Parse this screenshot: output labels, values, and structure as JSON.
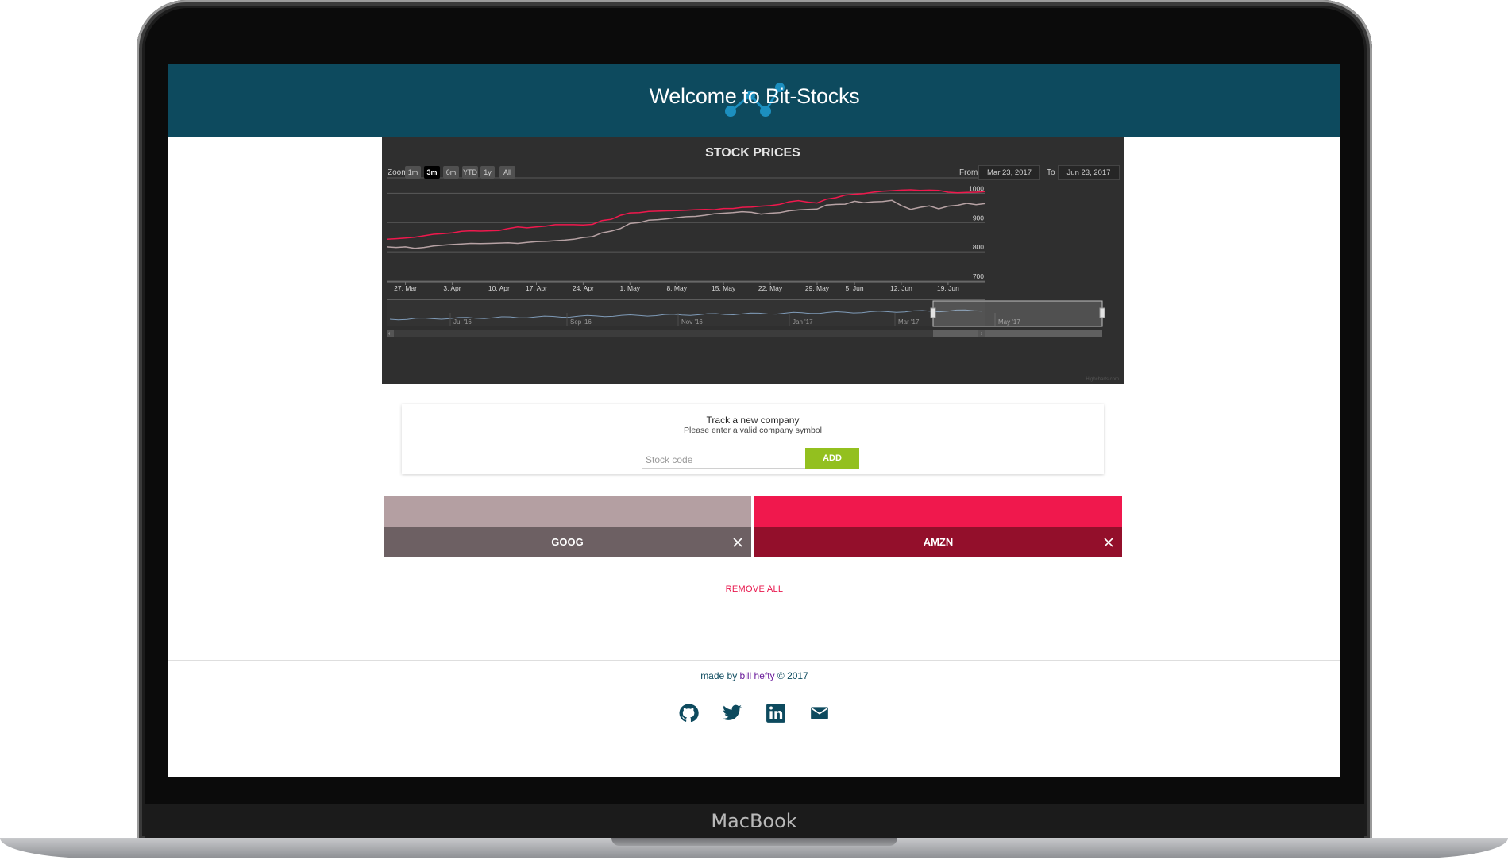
{
  "device": {
    "brand": "MacBook"
  },
  "header": {
    "title": "Welcome to Bit-Stocks"
  },
  "chart": {
    "title": "STOCK PRICES",
    "zoom_label": "Zoom",
    "zoom_buttons": [
      "1m",
      "3m",
      "6m",
      "YTD",
      "1y",
      "All"
    ],
    "active_zoom": "3m",
    "from_label": "From",
    "from_value": "Mar 23, 2017",
    "to_label": "To",
    "to_value": "Jun 23, 2017",
    "credit": "Highcharts.com",
    "colors": {
      "GOOG": "#b7a2a4",
      "AMZN": "#f0184d"
    }
  },
  "chart_data": {
    "type": "line",
    "title": "STOCK PRICES",
    "x": [
      "23 Mar",
      "24 Mar",
      "27 Mar",
      "28 Mar",
      "29 Mar",
      "30 Mar",
      "31 Mar",
      "3 Apr",
      "4 Apr",
      "5 Apr",
      "6 Apr",
      "7 Apr",
      "10 Apr",
      "11 Apr",
      "12 Apr",
      "13 Apr",
      "17 Apr",
      "18 Apr",
      "19 Apr",
      "20 Apr",
      "21 Apr",
      "24 Apr",
      "25 Apr",
      "26 Apr",
      "27 Apr",
      "28 Apr",
      "1 May",
      "2 May",
      "3 May",
      "4 May",
      "5 May",
      "8 May",
      "9 May",
      "10 May",
      "11 May",
      "12 May",
      "15 May",
      "16 May",
      "17 May",
      "18 May",
      "19 May",
      "22 May",
      "23 May",
      "24 May",
      "25 May",
      "26 May",
      "30 May",
      "31 May",
      "1 Jun",
      "2 Jun",
      "5 Jun",
      "6 Jun",
      "7 Jun",
      "8 Jun",
      "9 Jun",
      "12 Jun",
      "13 Jun",
      "14 Jun",
      "15 Jun",
      "16 Jun",
      "19 Jun",
      "20 Jun",
      "21 Jun",
      "22 Jun",
      "23 Jun"
    ],
    "series": [
      {
        "name": "AMZN",
        "values": [
          843,
          845,
          847,
          850,
          855,
          860,
          862,
          865,
          870,
          872,
          871,
          872,
          873,
          880,
          885,
          882,
          885,
          888,
          893,
          893,
          893,
          892,
          894,
          907,
          911,
          925,
          933,
          934,
          938,
          939,
          940,
          941,
          942,
          944,
          945,
          944,
          948,
          948,
          952,
          953,
          956,
          958,
          962,
          971,
          975,
          970,
          967,
          980,
          985,
          994,
          997,
          999,
          1004,
          1007,
          1009,
          1011,
          1012,
          1010,
          1011,
          1010,
          1004,
          1002,
          1003,
          1004,
          1006
        ]
      },
      {
        "name": "GOOG",
        "values": [
          817,
          815,
          817,
          812,
          815,
          820,
          823,
          825,
          827,
          829,
          828,
          829,
          830,
          831,
          829,
          832,
          835,
          836,
          838,
          840,
          843,
          849,
          852,
          865,
          871,
          880,
          897,
          900,
          908,
          910,
          913,
          917,
          920,
          921,
          925,
          930,
          932,
          934,
          937,
          935,
          929,
          932,
          934,
          940,
          943,
          945,
          946,
          960,
          962,
          963,
          973,
          968,
          971,
          972,
          976,
          958,
          945,
          952,
          957,
          947,
          956,
          959,
          966,
          961,
          965
        ]
      }
    ],
    "ylim": [
      700,
      1050
    ],
    "y_ticks": [
      "700",
      "800",
      "900",
      "1000"
    ],
    "x_ticks": [
      "27. Mar",
      "3. Apr",
      "10. Apr",
      "17. Apr",
      "24. Apr",
      "1. May",
      "8. May",
      "15. May",
      "22. May",
      "29. May",
      "5. Jun",
      "12. Jun",
      "19. Jun"
    ],
    "navigator_labels": [
      "Jul '16",
      "Sep '16",
      "Nov '16",
      "Jan '17",
      "Mar '17",
      "May '17"
    ],
    "grid": true
  },
  "track": {
    "title": "Track a new company",
    "subtitle": "Please enter a valid company symbol",
    "placeholder": "Stock code",
    "value": "",
    "add_label": "ADD"
  },
  "stocks": [
    {
      "symbol": "GOOG",
      "top_color": "#b49fa2",
      "bottom_color": "#6d6063"
    },
    {
      "symbol": "AMZN",
      "top_color": "#f0184d",
      "bottom_color": "#930f2b"
    }
  ],
  "remove_all_label": "REMOVE ALL",
  "footer": {
    "prefix": "made by ",
    "author": "bill hefty",
    "suffix": " © 2017",
    "icons": [
      "github-icon",
      "twitter-icon",
      "linkedin-icon",
      "mail-icon"
    ]
  }
}
